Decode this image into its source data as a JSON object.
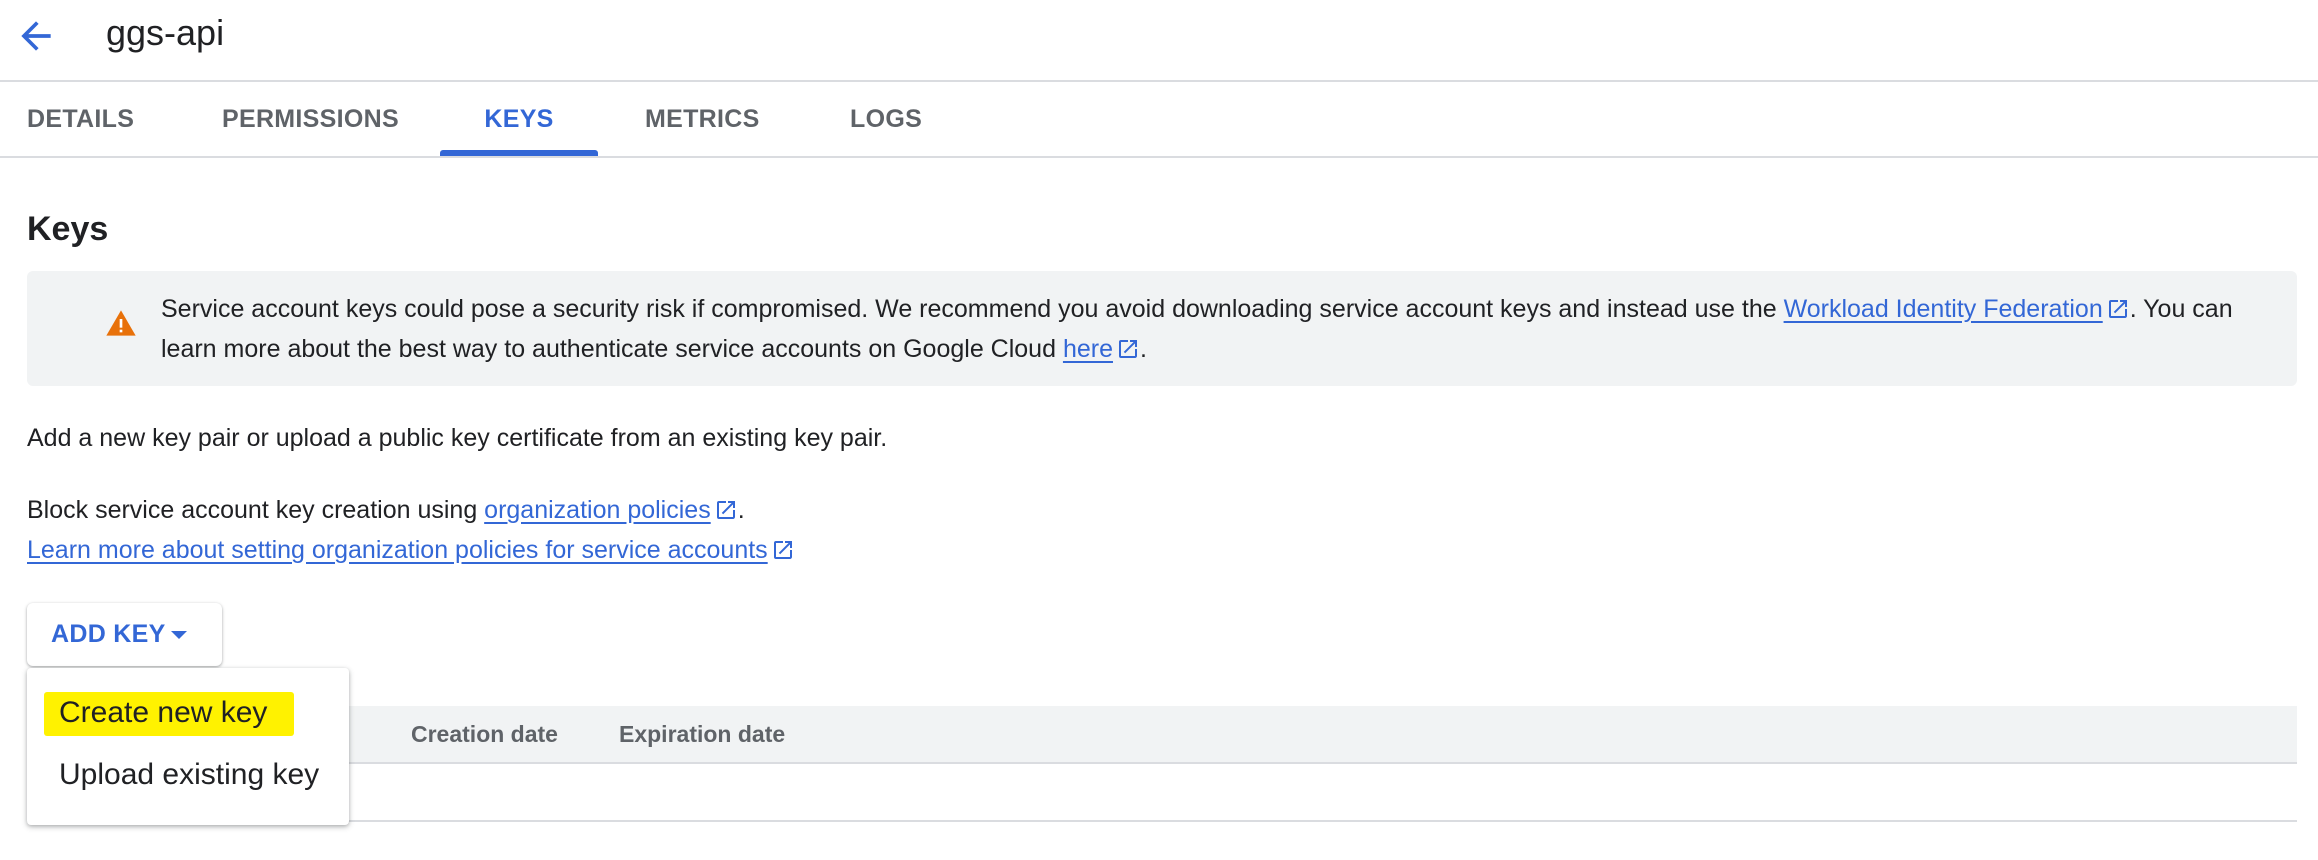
{
  "header": {
    "title": "ggs-api",
    "back_icon": "arrow-left-icon"
  },
  "tabs": [
    {
      "label": "DETAILS"
    },
    {
      "label": "PERMISSIONS"
    },
    {
      "label": "KEYS",
      "active": true
    },
    {
      "label": "METRICS"
    },
    {
      "label": "LOGS"
    }
  ],
  "section": {
    "title": "Keys"
  },
  "warning": {
    "text_1": "Service account keys could pose a security risk if compromised. We recommend you avoid downloading service account keys and instead use the ",
    "link_1": "Workload Identity Federation",
    "text_2": ". You can learn more about the best way to authenticate service accounts on Google Cloud ",
    "link_2": "here",
    "text_3": "."
  },
  "intro": {
    "add_text": "Add a new key pair or upload a public key certificate from an existing key pair.",
    "block_text": "Block service account key creation using ",
    "block_link": "organization policies",
    "block_end": ".",
    "learn_link": "Learn more about setting organization policies for service accounts"
  },
  "add_key": {
    "label": "ADD KEY"
  },
  "menu": {
    "items": [
      {
        "label": "Create new key",
        "highlighted": true
      },
      {
        "label": "Upload existing key"
      }
    ]
  },
  "table": {
    "columns": [
      "Creation date",
      "Expiration date"
    ]
  },
  "colors": {
    "accent": "#3367d6",
    "warning": "#e8710a",
    "highlight": "#fff200"
  }
}
